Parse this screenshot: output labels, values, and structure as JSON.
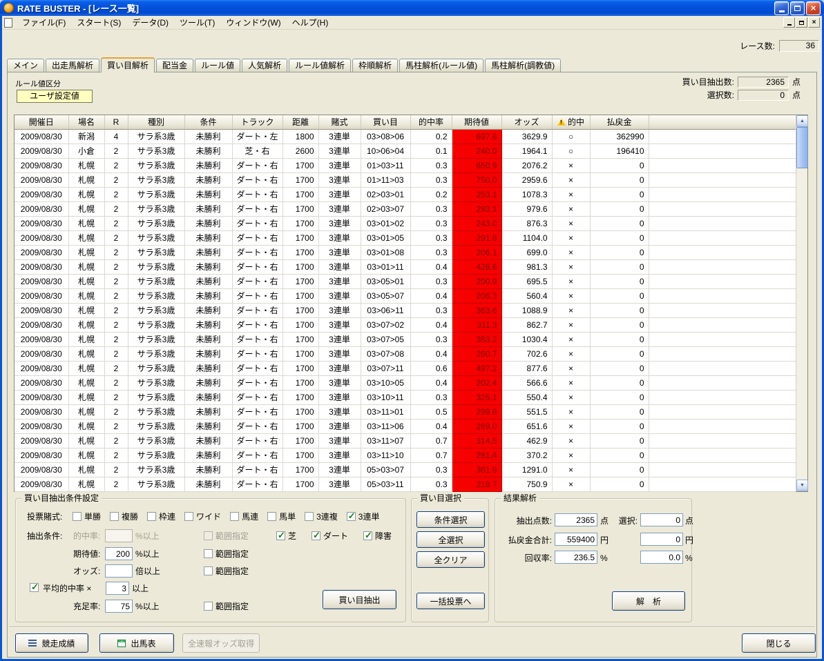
{
  "window": {
    "title": "RATE BUSTER - [レース一覧]"
  },
  "menu": {
    "items": [
      "ファイル(F)",
      "スタート(S)",
      "データ(D)",
      "ツール(T)",
      "ウィンドウ(W)",
      "ヘルプ(H)"
    ]
  },
  "header": {
    "race_count_label": "レース数:",
    "race_count_value": "36"
  },
  "tabs": [
    {
      "label": "メイン",
      "active": false
    },
    {
      "label": "出走馬解析",
      "active": false
    },
    {
      "label": "買い目解析",
      "active": true
    },
    {
      "label": "配当金",
      "active": false
    },
    {
      "label": "ルール値",
      "active": false
    },
    {
      "label": "人気解析",
      "active": false
    },
    {
      "label": "ルール値解析",
      "active": false
    },
    {
      "label": "枠順解析",
      "active": false
    },
    {
      "label": "馬柱解析(ルール値)",
      "active": false
    },
    {
      "label": "馬柱解析(調教値)",
      "active": false
    }
  ],
  "rule_value": {
    "label": "ルール値区分",
    "button_label": "ユーザ設定値"
  },
  "stats": {
    "extract_count_label": "買い目抽出数:",
    "extract_count_value": "2365",
    "extract_count_unit": "点",
    "selected_count_label": "選択数:",
    "selected_count_value": "0",
    "selected_count_unit": "点"
  },
  "table": {
    "headers": [
      "開催日",
      "場名",
      "R",
      "種別",
      "条件",
      "トラック",
      "距離",
      "賭式",
      "買い目",
      "的中率",
      "期待値",
      "オッズ",
      "的中",
      "払戻金"
    ],
    "rows": [
      [
        "2009/08/30",
        "新潟",
        "4",
        "サラ系3歳",
        "未勝利",
        "ダート・左",
        "1800",
        "3連単",
        "03>08>06",
        "0.2",
        "697.6",
        "3629.9",
        "○",
        "362990"
      ],
      [
        "2009/08/30",
        "小倉",
        "2",
        "サラ系3歳",
        "未勝利",
        "芝・右",
        "2600",
        "3連単",
        "10>06>04",
        "0.1",
        "240.0",
        "1964.1",
        "○",
        "196410"
      ],
      [
        "2009/08/30",
        "札幌",
        "2",
        "サラ系3歳",
        "未勝利",
        "ダート・右",
        "1700",
        "3連単",
        "01>03>11",
        "0.3",
        "650.9",
        "2076.2",
        "×",
        "0"
      ],
      [
        "2009/08/30",
        "札幌",
        "2",
        "サラ系3歳",
        "未勝利",
        "ダート・右",
        "1700",
        "3連単",
        "01>11>03",
        "0.3",
        "750.0",
        "2959.6",
        "×",
        "0"
      ],
      [
        "2009/08/30",
        "札幌",
        "2",
        "サラ系3歳",
        "未勝利",
        "ダート・右",
        "1700",
        "3連単",
        "02>03>01",
        "0.2",
        "253.1",
        "1078.3",
        "×",
        "0"
      ],
      [
        "2009/08/30",
        "札幌",
        "2",
        "サラ系3歳",
        "未勝利",
        "ダート・右",
        "1700",
        "3連単",
        "02>03>07",
        "0.3",
        "293.1",
        "979.6",
        "×",
        "0"
      ],
      [
        "2009/08/30",
        "札幌",
        "2",
        "サラ系3歳",
        "未勝利",
        "ダート・右",
        "1700",
        "3連単",
        "03>01>02",
        "0.3",
        "243.0",
        "876.3",
        "×",
        "0"
      ],
      [
        "2009/08/30",
        "札幌",
        "2",
        "サラ系3歳",
        "未勝利",
        "ダート・右",
        "1700",
        "3連単",
        "03>01>05",
        "0.3",
        "291.8",
        "1104.0",
        "×",
        "0"
      ],
      [
        "2009/08/30",
        "札幌",
        "2",
        "サラ系3歳",
        "未勝利",
        "ダート・右",
        "1700",
        "3連単",
        "03>01>08",
        "0.3",
        "206.1",
        "699.0",
        "×",
        "0"
      ],
      [
        "2009/08/30",
        "札幌",
        "2",
        "サラ系3歳",
        "未勝利",
        "ダート・右",
        "1700",
        "3連単",
        "03>01>11",
        "0.4",
        "428.6",
        "981.3",
        "×",
        "0"
      ],
      [
        "2009/08/30",
        "札幌",
        "2",
        "サラ系3歳",
        "未勝利",
        "ダート・右",
        "1700",
        "3連単",
        "03>05>01",
        "0.3",
        "200.9",
        "695.5",
        "×",
        "0"
      ],
      [
        "2009/08/30",
        "札幌",
        "2",
        "サラ系3歳",
        "未勝利",
        "ダート・右",
        "1700",
        "3連単",
        "03>05>07",
        "0.4",
        "206.3",
        "560.4",
        "×",
        "0"
      ],
      [
        "2009/08/30",
        "札幌",
        "2",
        "サラ系3歳",
        "未勝利",
        "ダート・右",
        "1700",
        "3連単",
        "03>06>11",
        "0.3",
        "363.6",
        "1088.9",
        "×",
        "0"
      ],
      [
        "2009/08/30",
        "札幌",
        "2",
        "サラ系3歳",
        "未勝利",
        "ダート・右",
        "1700",
        "3連単",
        "03>07>02",
        "0.4",
        "311.3",
        "862.7",
        "×",
        "0"
      ],
      [
        "2009/08/30",
        "札幌",
        "2",
        "サラ系3歳",
        "未勝利",
        "ダート・右",
        "1700",
        "3連単",
        "03>07>05",
        "0.3",
        "353.2",
        "1030.4",
        "×",
        "0"
      ],
      [
        "2009/08/30",
        "札幌",
        "2",
        "サラ系3歳",
        "未勝利",
        "ダート・右",
        "1700",
        "3連単",
        "03>07>08",
        "0.4",
        "260.7",
        "702.6",
        "×",
        "0"
      ],
      [
        "2009/08/30",
        "札幌",
        "2",
        "サラ系3歳",
        "未勝利",
        "ダート・右",
        "1700",
        "3連単",
        "03>07>11",
        "0.6",
        "497.2",
        "877.6",
        "×",
        "0"
      ],
      [
        "2009/08/30",
        "札幌",
        "2",
        "サラ系3歳",
        "未勝利",
        "ダート・右",
        "1700",
        "3連単",
        "03>10>05",
        "0.4",
        "202.4",
        "566.6",
        "×",
        "0"
      ],
      [
        "2009/08/30",
        "札幌",
        "2",
        "サラ系3歳",
        "未勝利",
        "ダート・右",
        "1700",
        "3連単",
        "03>10>11",
        "0.3",
        "325.1",
        "550.4",
        "×",
        "0"
      ],
      [
        "2009/08/30",
        "札幌",
        "2",
        "サラ系3歳",
        "未勝利",
        "ダート・右",
        "1700",
        "3連単",
        "03>11>01",
        "0.5",
        "299.8",
        "551.5",
        "×",
        "0"
      ],
      [
        "2009/08/30",
        "札幌",
        "2",
        "サラ系3歳",
        "未勝利",
        "ダート・右",
        "1700",
        "3連単",
        "03>11>06",
        "0.4",
        "269.0",
        "651.6",
        "×",
        "0"
      ],
      [
        "2009/08/30",
        "札幌",
        "2",
        "サラ系3歳",
        "未勝利",
        "ダート・右",
        "1700",
        "3連単",
        "03>11>07",
        "0.7",
        "314.5",
        "462.9",
        "×",
        "0"
      ],
      [
        "2009/08/30",
        "札幌",
        "2",
        "サラ系3歳",
        "未勝利",
        "ダート・右",
        "1700",
        "3連単",
        "03>11>10",
        "0.7",
        "261.4",
        "370.2",
        "×",
        "0"
      ],
      [
        "2009/08/30",
        "札幌",
        "2",
        "サラ系3歳",
        "未勝利",
        "ダート・右",
        "1700",
        "3連単",
        "05>03>07",
        "0.3",
        "361.9",
        "1291.0",
        "×",
        "0"
      ],
      [
        "2009/08/30",
        "札幌",
        "2",
        "サラ系3歳",
        "未勝利",
        "ダート・右",
        "1700",
        "3連単",
        "05>03>11",
        "0.3",
        "218.7",
        "750.9",
        "×",
        "0"
      ]
    ]
  },
  "extract_panel": {
    "title": "買い目抽出条件設定",
    "bet_row_label": "投票賭式:",
    "bet_types": [
      {
        "label": "単勝",
        "checked": false
      },
      {
        "label": "複勝",
        "checked": false
      },
      {
        "label": "枠連",
        "checked": false
      },
      {
        "label": "ワイド",
        "checked": false
      },
      {
        "label": "馬連",
        "checked": false
      },
      {
        "label": "馬単",
        "checked": false
      },
      {
        "label": "3連複",
        "checked": false
      },
      {
        "label": "3連単",
        "checked": true
      }
    ],
    "condition_row_label": "抽出条件:",
    "hit_rate": {
      "label": "的中率:",
      "value": "",
      "unit": "%以上",
      "range_label": "範囲指定"
    },
    "surfaces": [
      {
        "label": "芝",
        "checked": true
      },
      {
        "label": "ダート",
        "checked": true
      },
      {
        "label": "障害",
        "checked": true
      }
    ],
    "expected": {
      "label": "期待値:",
      "value": "200",
      "unit": "%以上",
      "range_label": "範囲指定"
    },
    "odds": {
      "label": "オッズ:",
      "value": "",
      "unit": "倍以上",
      "range_label": "範囲指定"
    },
    "avg_hit": {
      "label": "平均的中率 ×",
      "value": "3",
      "unit": "以上",
      "checked": true
    },
    "sufficiency": {
      "label": "充足率:",
      "value": "75",
      "unit": "%以上",
      "range_label": "範囲指定"
    },
    "extract_button": "買い目抽出"
  },
  "selection_panel": {
    "title": "買い目選択",
    "condition_select_button": "条件選択",
    "select_all_button": "全選択",
    "clear_all_button": "全クリア",
    "batch_vote_button": "一括投票へ"
  },
  "result_panel": {
    "title": "結果解析",
    "points": {
      "label": "抽出点数:",
      "value": "2365",
      "unit": "点",
      "label2": "選択:",
      "value2": "0",
      "unit2": "点"
    },
    "payout": {
      "label": "払戻金合計:",
      "value": "559400",
      "unit": "円",
      "value2": "0",
      "unit2": "円"
    },
    "recovery": {
      "label": "回収率:",
      "value": "236.5",
      "unit": "%",
      "value2": "0.0",
      "unit2": "%"
    },
    "analyze_button": "解　析"
  },
  "bottom_bar": {
    "race_results_button": "競走成績",
    "entry_table_button": "出馬表",
    "odds_fetch_button": "全速報オッズ取得",
    "close_button": "閉じる"
  },
  "colors": {
    "highlight_cell_bg": "#f60000",
    "highlight_cell_text": "#7e0000",
    "titlebar_blue": "#0353dd",
    "dialog_beige": "#ece9d8",
    "rule_button_yellow": "#ffffc0"
  }
}
